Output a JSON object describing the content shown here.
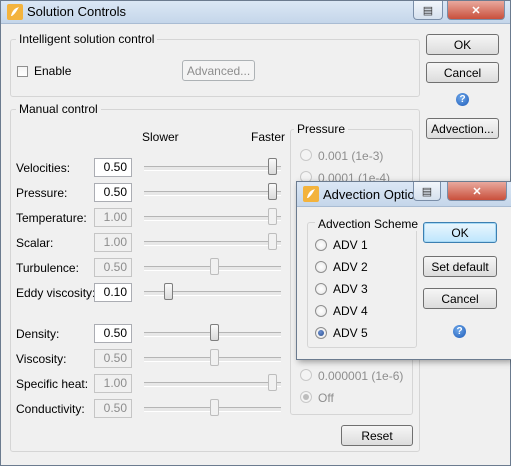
{
  "main": {
    "title": "Solution Controls",
    "ok": "OK",
    "cancel": "Cancel",
    "advection": "Advection...",
    "intelligent": {
      "label": "Intelligent solution control",
      "enable": "Enable",
      "enabled": false,
      "advanced": "Advanced..."
    },
    "manual": {
      "label": "Manual control",
      "slower": "Slower",
      "faster": "Faster",
      "rows": [
        {
          "label": "Velocities:",
          "value": "0.50",
          "enabled": true,
          "level": 1.0
        },
        {
          "label": "Pressure:",
          "value": "0.50",
          "enabled": true,
          "level": 1.0
        },
        {
          "label": "Temperature:",
          "value": "1.00",
          "enabled": false,
          "level": 1.0
        },
        {
          "label": "Scalar:",
          "value": "1.00",
          "enabled": false,
          "level": 1.0
        },
        {
          "label": "Turbulence:",
          "value": "0.50",
          "enabled": false,
          "level": 0.5
        },
        {
          "label": "Eddy viscosity:",
          "value": "0.10",
          "enabled": true,
          "level": 0.1
        },
        {
          "label": "Density:",
          "value": "0.50",
          "enabled": true,
          "level": 0.5
        },
        {
          "label": "Viscosity:",
          "value": "0.50",
          "enabled": false,
          "level": 0.5
        },
        {
          "label": "Specific heat:",
          "value": "1.00",
          "enabled": false,
          "level": 1.0
        },
        {
          "label": "Conductivity:",
          "value": "0.50",
          "enabled": false,
          "level": 0.5
        }
      ],
      "reset": "Reset"
    },
    "pressure": {
      "label": "Pressure",
      "options": [
        "0.001 (1e-3)",
        "0.0001 (1e-4)",
        "0.000001 (1e-6)",
        "Off"
      ],
      "selected": "Off"
    }
  },
  "advection_dialog": {
    "title": "Advection Options",
    "scheme_label": "Advection Scheme",
    "options": [
      "ADV 1",
      "ADV 2",
      "ADV 3",
      "ADV 4",
      "ADV 5"
    ],
    "selected": "ADV 5",
    "ok": "OK",
    "set_default": "Set default",
    "cancel": "Cancel"
  }
}
